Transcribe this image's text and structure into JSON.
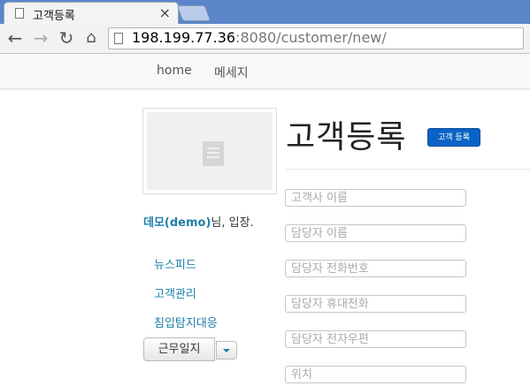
{
  "browser": {
    "tab_title": "고객등록",
    "tab_close": "×",
    "url_host": "198.199.77.36",
    "url_rest": ":8080/customer/new/",
    "icons": [
      "document-icon",
      "close-icon",
      "back-icon",
      "forward-icon",
      "reload-icon",
      "home-icon"
    ]
  },
  "navbar": {
    "home": "home",
    "messages": "메세지"
  },
  "sidebar": {
    "user_name": "데모(demo)",
    "greeting_suffix": "님, 입장.",
    "links": [
      "뉴스피드",
      "고객관리",
      "침입탐지대응"
    ],
    "work_log_button": "근무일지"
  },
  "main": {
    "title": "고객등록",
    "badge": "고객 등록",
    "fields": [
      {
        "placeholder": "고객사 이름",
        "value": ""
      },
      {
        "placeholder": "담당자 이름",
        "value": ""
      },
      {
        "placeholder": "담당자 전화번호",
        "value": ""
      },
      {
        "placeholder": "담당자 휴대전화",
        "value": ""
      },
      {
        "placeholder": "담당자 전자우편",
        "value": ""
      },
      {
        "placeholder": "위치",
        "value": ""
      }
    ]
  },
  "colors": {
    "link": "#1e7fa8",
    "badge": "#0a63c6",
    "tabstrip": "#5a86c9"
  }
}
